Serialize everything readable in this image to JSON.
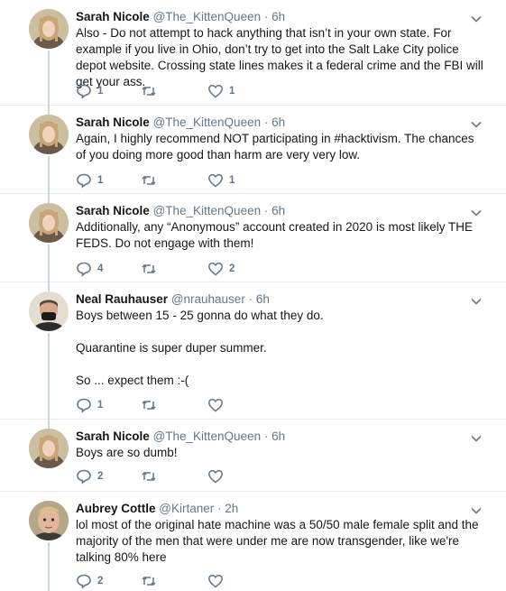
{
  "tweets": [
    {
      "name": "Sarah Nicole",
      "handle": "@The_KittenQueen",
      "dot": "·",
      "time": "6h",
      "avatar": "sarah-avatar",
      "text": [
        "Also - Do not attempt to hack anything that isn’t in your own state. For example if you live in Ohio, don’t try to get into the Salt Lake City police depot website. Crossing state lines makes it a federal crime and the FBI will get your ass."
      ],
      "replies": "1",
      "retweets": "",
      "likes": "1"
    },
    {
      "name": "Sarah Nicole",
      "handle": "@The_KittenQueen",
      "dot": "·",
      "time": "6h",
      "avatar": "sarah-avatar",
      "text": [
        "Again, I highly recommend NOT participating in #hacktivism. The chances of you doing more good than harm are very very low."
      ],
      "replies": "1",
      "retweets": "",
      "likes": "1"
    },
    {
      "name": "Sarah Nicole",
      "handle": "@The_KittenQueen",
      "dot": "·",
      "time": "6h",
      "avatar": "sarah-avatar",
      "text": [
        "Additionally, any “Anonymous” account created in 2020 is most likely THE FEDS. Do not engage with them!"
      ],
      "replies": "4",
      "retweets": "",
      "likes": "2"
    },
    {
      "name": "Neal Rauhauser",
      "handle": "@nrauhauser",
      "dot": "·",
      "time": "6h",
      "avatar": "neal-avatar",
      "text": [
        "Boys between 15 - 25 gonna do what they do.",
        "Quarantine is super duper summer.",
        "So ... expect them :-("
      ],
      "replies": "1",
      "retweets": "",
      "likes": ""
    },
    {
      "name": "Sarah Nicole",
      "handle": "@The_KittenQueen",
      "dot": "·",
      "time": "6h",
      "avatar": "sarah-avatar",
      "text": [
        "Boys are so dumb!"
      ],
      "replies": "2",
      "retweets": "",
      "likes": ""
    },
    {
      "name": "Aubrey Cottle",
      "handle": "@Kirtaner",
      "dot": "·",
      "time": "2h",
      "avatar": "aubrey-avatar",
      "text": [
        "lol most of the original hate machine was a 50/50 male female split and the majority of the men that were under me are now transgender, like we're talking 80% here"
      ],
      "replies": "2",
      "retweets": "",
      "likes": ""
    }
  ],
  "colors": {
    "text": "#14171a",
    "muted": "#657786",
    "line": "#ccd6dd"
  }
}
